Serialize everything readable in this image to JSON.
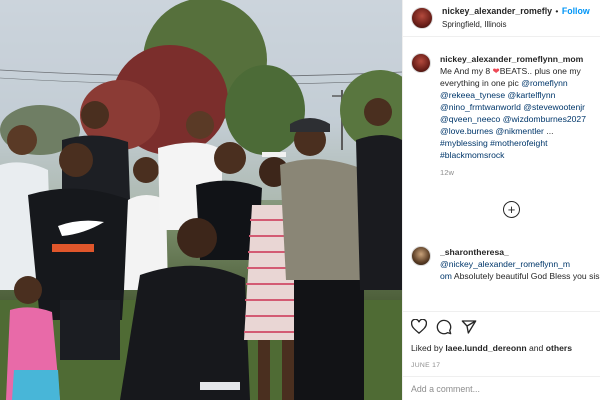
{
  "post": {
    "username": "nickey_alexander_romefly",
    "follow_label": "Follow",
    "location": "Springfield, Illinois"
  },
  "caption": {
    "username": "nickey_alexander_romeflynn_mom",
    "text_start": "Me And my 8 ",
    "heart": "❤",
    "text_after": "BEATS.. plus one my everything in one pic ",
    "tags": [
      "@romeflynn",
      "@rekeea_tynese",
      "@kartelflynn",
      "@nino_frmtwanworld",
      "@stevewootenjr",
      "@qveen_neeco",
      "@wizdomburnes2027",
      "@love.burnes",
      "@nikmentler",
      "...",
      "#myblessing",
      "#motherofeight",
      "#blackmomsrock"
    ],
    "age": "12w"
  },
  "comment": {
    "username": "_sharontheresa_",
    "mention": "@nickey_alexander_romeflynn_m",
    "mention_tail": "om",
    "text": "Absolutely beautiful God Bless you sis!"
  },
  "load_more_icon": "plus-circle-icon",
  "actions": {
    "icons": [
      "heart-icon",
      "comment-icon",
      "share-icon"
    ],
    "liked_by_prefix": "Liked by ",
    "liked_by_user": "laee.lundd_dereonn",
    "liked_by_suffix": " and ",
    "liked_by_others": "others",
    "date": "JUNE 17"
  },
  "add_comment_placeholder": "Add a comment..."
}
